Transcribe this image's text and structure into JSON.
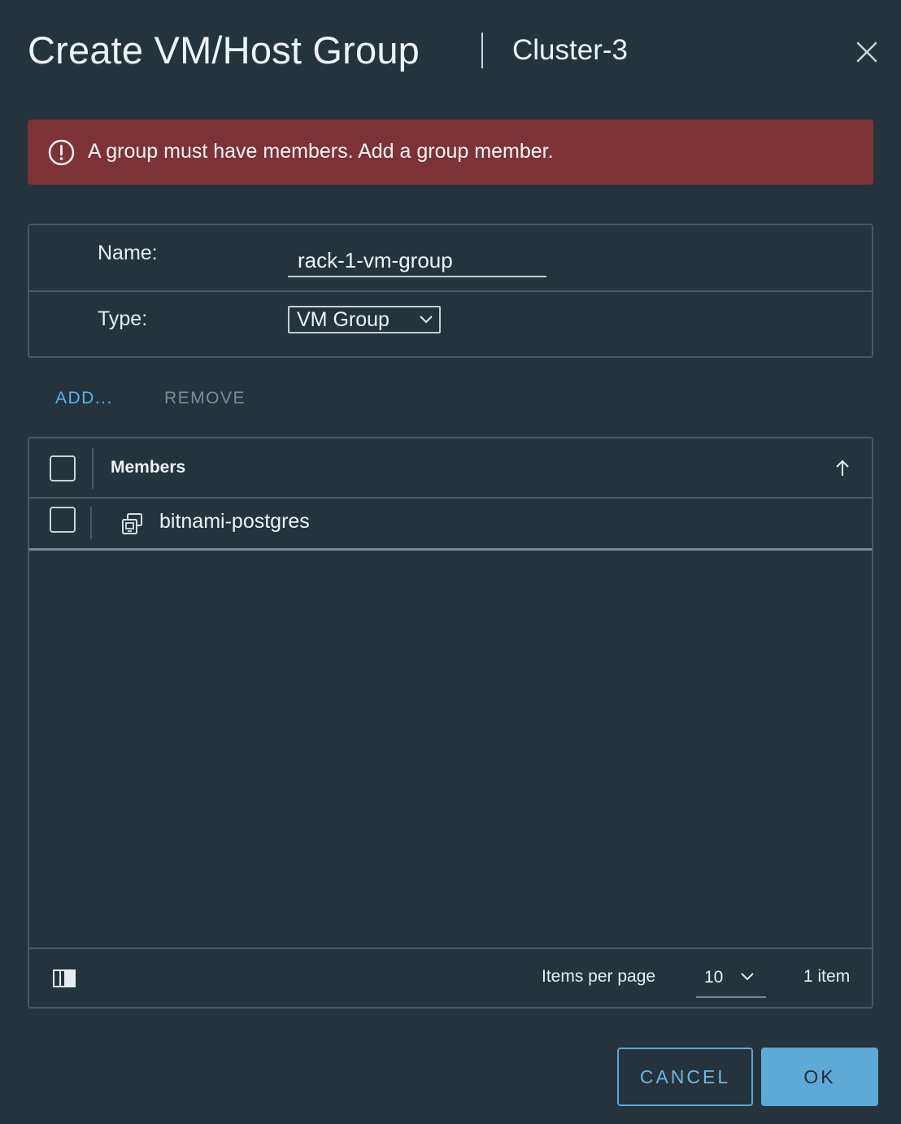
{
  "header": {
    "title": "Create VM/Host Group",
    "subtitle": "Cluster-3",
    "close_icon": "close-icon"
  },
  "alert": {
    "icon": "error-circle-icon",
    "message": "A group must have members. Add a group member.",
    "color": "#7d3236"
  },
  "form": {
    "name_label": "Name:",
    "name_value": "rack-1-vm-group",
    "type_label": "Type:",
    "type_value": "VM Group"
  },
  "actions": {
    "add_label": "ADD...",
    "remove_label": "REMOVE"
  },
  "grid": {
    "column_header": "Members",
    "sort_icon": "sort-ascending-icon",
    "rows": [
      {
        "icon": "vm-icon",
        "name": "bitnami-postgres"
      }
    ],
    "footer": {
      "column_toggle_icon": "column-toggle-icon",
      "items_per_page_label": "Items per page",
      "items_per_page_value": "10",
      "count_text": "1 item"
    }
  },
  "buttons": {
    "cancel_label": "CANCEL",
    "ok_label": "OK"
  },
  "colors": {
    "background": "#25333d",
    "accent": "#5ea9d6",
    "link": "#5ab4e8",
    "error": "#7d3236"
  }
}
